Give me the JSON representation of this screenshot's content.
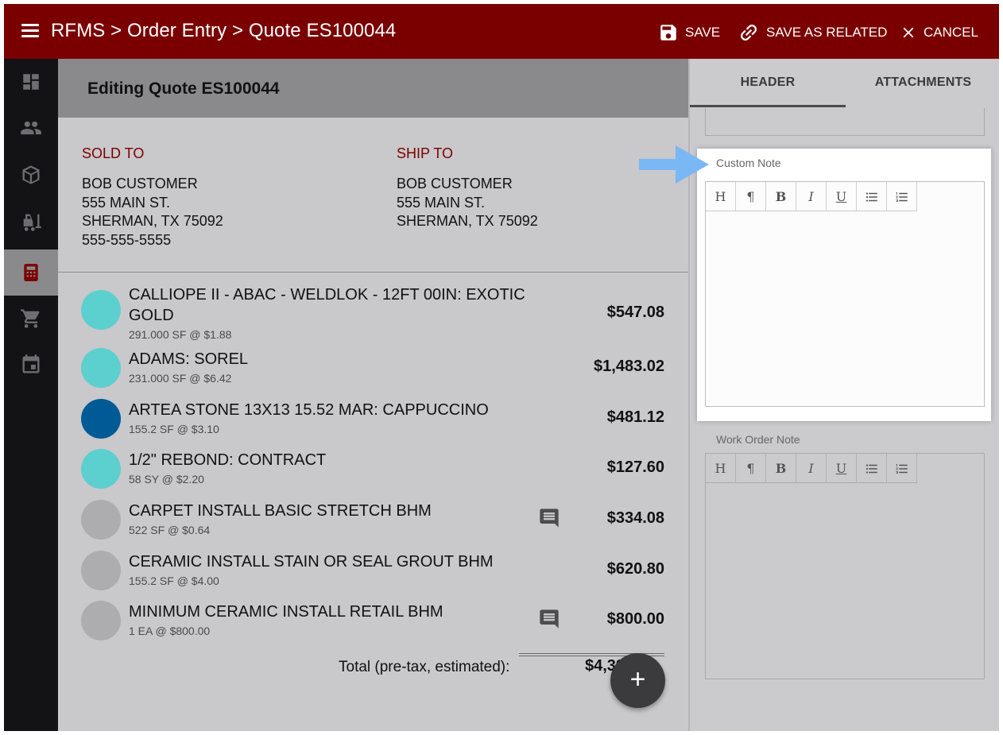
{
  "topbar": {
    "breadcrumb": "RFMS > Order Entry > Quote ES100044",
    "save_label": "SAVE",
    "save_related_label": "SAVE AS RELATED",
    "cancel_label": "CANCEL"
  },
  "colors": {
    "brand": "#7a0000",
    "sidebar": "#131316",
    "teal": "#5ccfcf",
    "blue": "#005a96",
    "gray": "#adadb0",
    "highlight_arrow": "#7ab8f5"
  },
  "sidebar": {
    "items": [
      {
        "icon": "dashboard-icon"
      },
      {
        "icon": "people-icon"
      },
      {
        "icon": "package-icon"
      },
      {
        "icon": "forklift-icon"
      },
      {
        "icon": "calculator-icon",
        "active": true
      },
      {
        "icon": "cart-icon"
      },
      {
        "icon": "calendar-icon"
      }
    ]
  },
  "main": {
    "title": "Editing Quote ES100044",
    "sold_to": {
      "label": "SOLD TO",
      "name": "BOB CUSTOMER",
      "street": "555 MAIN ST.",
      "city": "SHERMAN, TX 75092",
      "phone": "555-555-5555"
    },
    "ship_to": {
      "label": "SHIP TO",
      "name": "BOB CUSTOMER",
      "street": "555 MAIN ST.",
      "city": "SHERMAN, TX 75092"
    },
    "line_items": [
      {
        "name": "CALLIOPE II - ABAC - WELDLOK - 12FT 00IN: EXOTIC GOLD",
        "detail": "291.000 SF @ $1.88",
        "price": "$547.08",
        "swatch": "teal",
        "has_note": false
      },
      {
        "name": "ADAMS: SOREL",
        "detail": "231.000 SF @ $6.42",
        "price": "$1,483.02",
        "swatch": "teal",
        "has_note": false
      },
      {
        "name": "ARTEA STONE 13X13 15.52 MAR: CAPPUCCINO",
        "detail": "155.2 SF @ $3.10",
        "price": "$481.12",
        "swatch": "blue",
        "has_note": false
      },
      {
        "name": "1/2\" REBOND: CONTRACT",
        "detail": "58 SY @ $2.20",
        "price": "$127.60",
        "swatch": "teal",
        "has_note": false
      },
      {
        "name": "CARPET INSTALL BASIC STRETCH BHM",
        "detail": "522 SF @ $0.64",
        "price": "$334.08",
        "swatch": "gray",
        "has_note": true
      },
      {
        "name": "CERAMIC INSTALL STAIN OR SEAL GROUT BHM",
        "detail": "155.2 SF @ $4.00",
        "price": "$620.80",
        "swatch": "gray",
        "has_note": false
      },
      {
        "name": "MINIMUM CERAMIC INSTALL RETAIL BHM",
        "detail": "1 EA @ $800.00",
        "price": "$800.00",
        "swatch": "gray",
        "has_note": true
      }
    ],
    "total_label": "Total (pre-tax, estimated):",
    "total_value": "$4,394.00",
    "fab_label": "+"
  },
  "right": {
    "tabs": [
      {
        "label": "HEADER",
        "active": true
      },
      {
        "label": "ATTACHMENTS",
        "active": false
      }
    ],
    "custom_note": {
      "label": "Custom Note",
      "value": ""
    },
    "work_order_note": {
      "label": "Work Order Note",
      "value": ""
    },
    "toolbar": [
      "H",
      "¶",
      "B",
      "I",
      "U",
      "bulleted-list-icon",
      "numbered-list-icon"
    ]
  }
}
